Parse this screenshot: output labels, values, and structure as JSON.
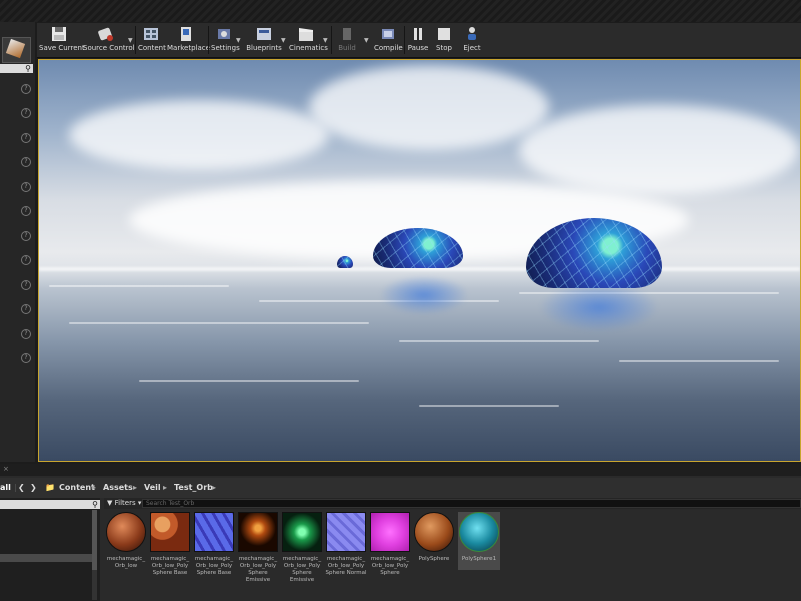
{
  "toolbar": {
    "buttons": [
      {
        "label": "Save Current",
        "icon": "save-icon"
      },
      {
        "label": "Source Control",
        "icon": "source-control-icon"
      },
      {
        "label": "Content",
        "icon": "content-icon"
      },
      {
        "label": "Marketplace",
        "icon": "marketplace-icon"
      },
      {
        "label": "Settings",
        "icon": "settings-icon"
      },
      {
        "label": "Blueprints",
        "icon": "blueprints-icon"
      },
      {
        "label": "Cinematics",
        "icon": "cinematics-icon"
      },
      {
        "label": "Build",
        "icon": "build-icon"
      },
      {
        "label": "Compile",
        "icon": "compile-icon"
      },
      {
        "label": "Pause",
        "icon": "pause-icon"
      },
      {
        "label": "Stop",
        "icon": "stop-icon"
      },
      {
        "label": "Eject",
        "icon": "eject-icon"
      }
    ]
  },
  "content_browser": {
    "tab_fragment": "all",
    "path": [
      "Content",
      "Assets",
      "Veil",
      "Test_Orb"
    ],
    "filters_label": "Filters",
    "search_placeholder": "Search Test_Orb",
    "assets": [
      {
        "name": "mechamagic_ Orb_low",
        "color": "#8a3a1a"
      },
      {
        "name": "mechamagic_ Orb_low_Poly Sphere Base",
        "color": "#c25a2a"
      },
      {
        "name": "mechamagic_ Orb_low_Poly Sphere Base",
        "color": "#4a5ad8"
      },
      {
        "name": "mechamagic_ Orb_low_Poly Sphere Emissive",
        "color": "#d86a20"
      },
      {
        "name": "mechamagic_ Orb_low_Poly Sphere Emissive",
        "color": "#1a9a4a"
      },
      {
        "name": "mechamagic_ Orb_low_Poly Sphere Normal",
        "color": "#7a7ae8"
      },
      {
        "name": "mechamagic_ Orb_low_Poly Sphere",
        "color": "#e040e0"
      },
      {
        "name": "PolySphere",
        "color": "#9a4a1a"
      },
      {
        "name": "PolySphere1",
        "color": "#1a8aa0"
      }
    ]
  }
}
